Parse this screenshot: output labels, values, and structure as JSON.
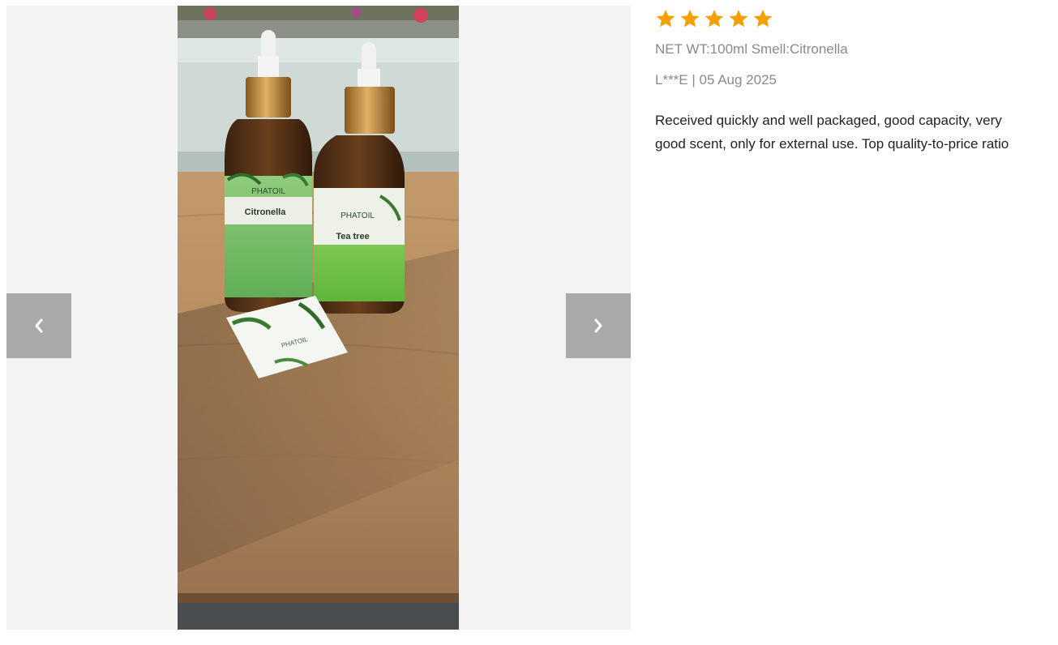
{
  "gallery": {
    "prev_icon": "chevron-left-icon",
    "next_icon": "chevron-right-icon",
    "photo_labels": {
      "bottle_left_brand": "PHATOIL",
      "bottle_left_name": "Citronella",
      "bottle_right_brand": "PHATOIL",
      "bottle_right_name": "Tea tree",
      "card_brand": "PHATOIL"
    }
  },
  "review": {
    "rating": 5,
    "rating_max": 5,
    "star_color": "#f5a000",
    "star_icon": "star-icon",
    "sku": "NET WT:100ml Smell:Citronella",
    "meta": "L***E | 05 Aug 2025",
    "text": "Received quickly and well packaged, good capacity, very good scent, only for external use. Top quality-to-price ratio"
  }
}
